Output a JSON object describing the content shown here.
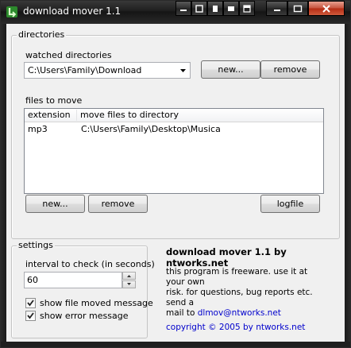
{
  "window": {
    "title": "download mover 1.1"
  },
  "directories": {
    "group_title": "directories",
    "watched_label": "watched directories",
    "watched_selected": "C:\\Users\\Family\\Download",
    "new_button": "new...",
    "remove_button": "remove",
    "files_label": "files to move",
    "columns": [
      "extension",
      "move files to directory"
    ],
    "rows": [
      {
        "extension": "mp3",
        "directory": "C:\\Users\\Family\\Desktop\\Musica"
      }
    ],
    "files_new_button": "new...",
    "files_remove_button": "remove",
    "logfile_button": "logfile"
  },
  "settings": {
    "group_title": "settings",
    "interval_label": "interval to check (in seconds)",
    "interval_value": "60",
    "show_moved_label": "show file moved message",
    "show_moved_checked": true,
    "show_error_label": "show error message",
    "show_error_checked": true
  },
  "about": {
    "title": "download mover 1.1 by ntworks.net",
    "text_line1": "this program is freeware. use it at your own",
    "text_line2": "risk. for questions, bug reports etc. send a",
    "text_line3_prefix": "mail to",
    "email": "dlmov@ntworks.net",
    "copyright": "copyright © 2005 by ntworks.net"
  }
}
